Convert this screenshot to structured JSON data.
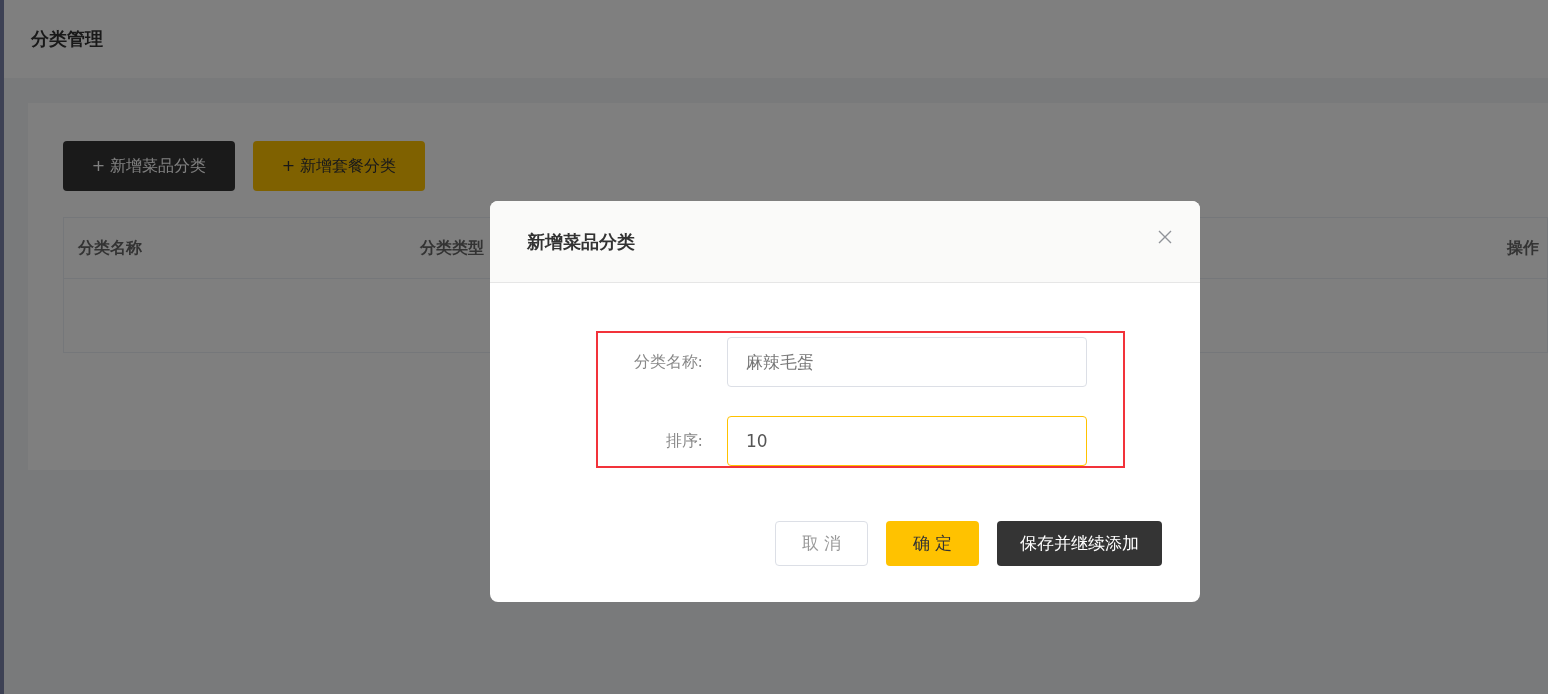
{
  "page": {
    "title": "分类管理"
  },
  "toolbar": {
    "buttons": [
      {
        "label": "+ 新增菜品分类",
        "kind": "dark"
      },
      {
        "label": "+ 新增套餐分类",
        "kind": "primary"
      }
    ]
  },
  "table": {
    "columns": [
      "分类名称",
      "分类类型",
      "操作"
    ]
  },
  "dialog": {
    "title": "新增菜品分类",
    "fields": [
      {
        "label": "分类名称:",
        "value": "麻辣毛蛋",
        "focused": false
      },
      {
        "label": "排序:",
        "value": "10",
        "focused": true
      }
    ],
    "buttons": [
      {
        "label": "取 消",
        "kind": "default"
      },
      {
        "label": "确 定",
        "kind": "primary"
      },
      {
        "label": "保存并继续添加",
        "kind": "dark"
      }
    ]
  }
}
